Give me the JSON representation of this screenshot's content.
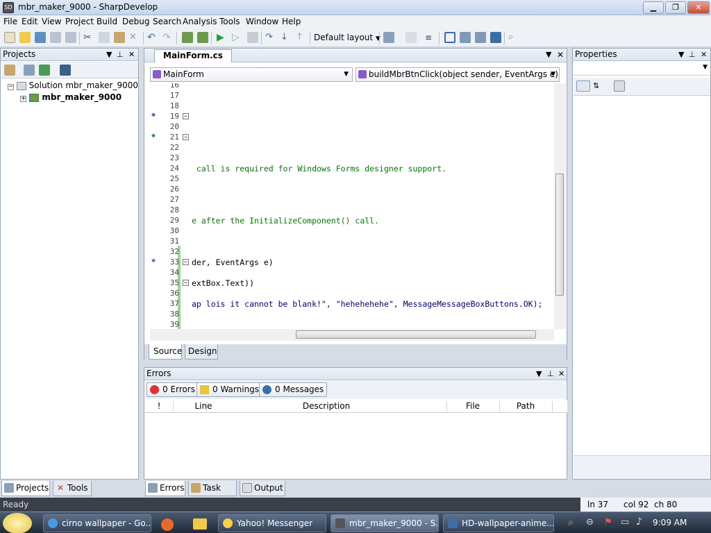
{
  "window": {
    "title": "mbr_maker_9000 - SharpDevelop",
    "app_icon_text": "SD",
    "min": "▁",
    "max": "❐",
    "close": "✕"
  },
  "menu": [
    "File",
    "Edit",
    "View",
    "Project",
    "Build",
    "Debug",
    "Search",
    "Analysis",
    "Tools",
    "Window",
    "Help"
  ],
  "toolbar": {
    "layout_label": "Default layout"
  },
  "projects_pad": {
    "title": "Projects",
    "solution_label": "Solution mbr_maker_9000",
    "project_label": "mbr_maker_9000",
    "tabs": [
      "Projects",
      "Tools"
    ]
  },
  "editor": {
    "doc_tab": "MainForm.cs",
    "class_combo": "MainForm",
    "member_combo": "buildMbrBtnClick(object sender, EventArgs e)",
    "lines": [
      {
        "n": "16",
        "text": ""
      },
      {
        "n": "17",
        "text": ""
      },
      {
        "n": "18",
        "text": ""
      },
      {
        "n": "19",
        "text": ""
      },
      {
        "n": "20",
        "text": ""
      },
      {
        "n": "21",
        "text": ""
      },
      {
        "n": "22",
        "text": ""
      },
      {
        "n": "23",
        "text": ""
      },
      {
        "n": "24",
        "text": " call is required for Windows Forms designer support."
      },
      {
        "n": "25",
        "text": ""
      },
      {
        "n": "26",
        "text": ""
      },
      {
        "n": "27",
        "text": ""
      },
      {
        "n": "28",
        "text": ""
      },
      {
        "n": "29",
        "text": "e after the InitializeComponent() call."
      },
      {
        "n": "30",
        "text": ""
      },
      {
        "n": "31",
        "text": ""
      },
      {
        "n": "32",
        "text": ""
      },
      {
        "n": "33",
        "text": "der, EventArgs e)"
      },
      {
        "n": "34",
        "text": ""
      },
      {
        "n": "35",
        "text": "extBox.Text))"
      },
      {
        "n": "36",
        "text": ""
      },
      {
        "n": "37",
        "text": "ap lois it cannot be blank!\", \"hehehehehe\", MessageMessageBoxButtons.OK);"
      },
      {
        "n": "38",
        "text": ""
      },
      {
        "n": "39",
        "text": ""
      }
    ],
    "view_tabs": [
      "Source",
      "Design"
    ]
  },
  "errors_pad": {
    "title": "Errors",
    "errors_btn": "0 Errors",
    "warnings_btn": "0 Warnings",
    "messages_btn": "0 Messages",
    "columns": [
      "!",
      "Line",
      "Description",
      "File",
      "Path"
    ],
    "tabs": [
      "Errors",
      "Task List",
      "Output"
    ]
  },
  "properties_pad": {
    "title": "Properties"
  },
  "status": {
    "ready": "Ready",
    "line": "ln 37",
    "col": "col 92",
    "ch": "ch 80"
  },
  "taskbar": {
    "items": [
      "cirno wallpaper - Go...",
      "Yahoo! Messenger",
      "mbr_maker_9000 - S...",
      "HD-wallpaper-anime..."
    ],
    "clock": "9:09 AM"
  },
  "colors": {
    "accent": "#3b6ea5",
    "comment": "#008000",
    "keyword_type": "#2b91af",
    "string": "#000080",
    "class_ref": "#a31515"
  }
}
